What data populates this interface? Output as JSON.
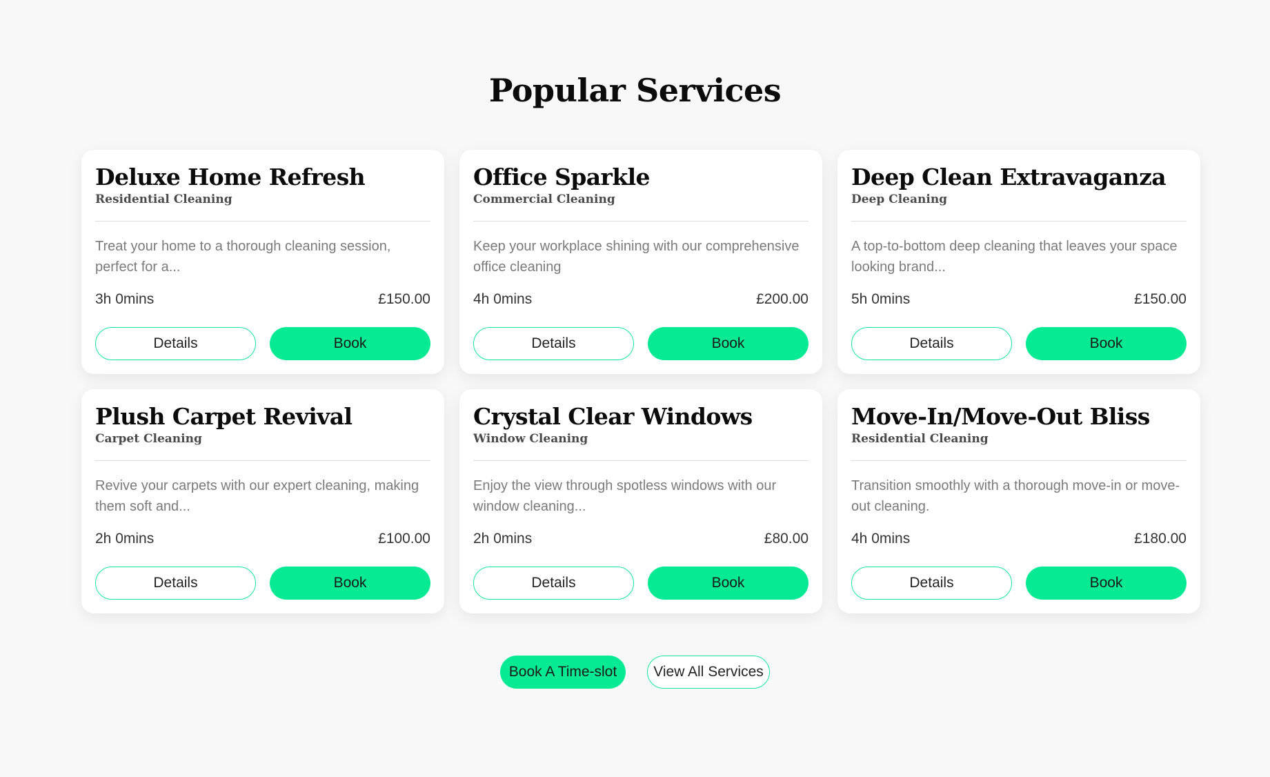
{
  "section": {
    "title": "Popular Services"
  },
  "services": [
    {
      "title": "Deluxe Home Refresh",
      "category": "Residential Cleaning",
      "description": "Treat your home to a thorough cleaning session, perfect for a...",
      "duration": "3h 0mins",
      "price": "£150.00",
      "details_label": "Details",
      "book_label": "Book"
    },
    {
      "title": "Office Sparkle",
      "category": "Commercial Cleaning",
      "description": "Keep your workplace shining with our comprehensive office cleaning",
      "duration": "4h 0mins",
      "price": "£200.00",
      "details_label": "Details",
      "book_label": "Book"
    },
    {
      "title": "Deep Clean Extravaganza",
      "category": "Deep Cleaning",
      "description": "A top-to-bottom deep cleaning that leaves your space looking brand...",
      "duration": "5h 0mins",
      "price": "£150.00",
      "details_label": "Details",
      "book_label": "Book"
    },
    {
      "title": "Plush Carpet Revival",
      "category": "Carpet Cleaning",
      "description": "Revive your carpets with our expert cleaning, making them soft and...",
      "duration": "2h 0mins",
      "price": "£100.00",
      "details_label": "Details",
      "book_label": "Book"
    },
    {
      "title": "Crystal Clear Windows",
      "category": "Window Cleaning",
      "description": "Enjoy the view through spotless windows with our window cleaning...",
      "duration": "2h 0mins",
      "price": "£80.00",
      "details_label": "Details",
      "book_label": "Book"
    },
    {
      "title": "Move-In/Move-Out Bliss",
      "category": "Residential Cleaning",
      "description": "Transition smoothly with a thorough move-in or move-out cleaning.",
      "duration": "4h 0mins",
      "price": "£180.00",
      "details_label": "Details",
      "book_label": "Book"
    }
  ],
  "actions": {
    "book_timeslot_label": "Book A Time-slot",
    "view_all_label": "View All Services"
  },
  "colors": {
    "accent": "#06eb93",
    "background": "#f8f8f8",
    "card": "#ffffff"
  }
}
